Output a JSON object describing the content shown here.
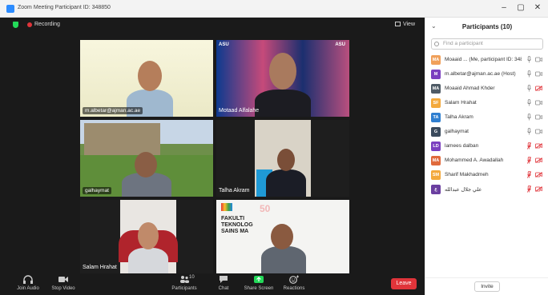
{
  "window": {
    "title": "Zoom Meeting Participant ID: 348850"
  },
  "meeting": {
    "recording_label": "Recording",
    "view_label": "View"
  },
  "tiles": [
    {
      "name": "m.albetar@ajman.ac.ae",
      "active_speaker": true
    },
    {
      "name": "Motaad Alfalahe"
    },
    {
      "name": "galhaymat"
    },
    {
      "name": "Talha Akram"
    },
    {
      "name": "Salam Hrahat"
    },
    {
      "name": ""
    }
  ],
  "tile_text": {
    "asu_logo": "ASU",
    "fakulti_banner": [
      "FAKULTI",
      "TEKNOLOG",
      "SAINS MA"
    ],
    "fakulti_number": "50"
  },
  "toolbar": {
    "join_audio": "Join Audio",
    "stop_video": "Stop Video",
    "participants": "Participants",
    "participants_count": "10",
    "chat": "Chat",
    "share_screen": "Share Screen",
    "reactions": "Reactions",
    "leave": "Leave"
  },
  "panel": {
    "title": "Participants (10)",
    "search_placeholder": "Find a participant",
    "invite": "Invite",
    "participants": [
      {
        "initials": "MA",
        "color": "#f0a05a",
        "name": "Moaaid ... (Me, participant ID: 348850)",
        "mic_muted": false,
        "cam_off": false
      },
      {
        "initials": "M",
        "color": "#7b3fbf",
        "name": "m.albetar@ajman.ac.ae (Host)",
        "mic_muted": false,
        "cam_off": false
      },
      {
        "initials": "MA",
        "color": "#4f5b66",
        "name": "Moaaid Ahmad Khder",
        "mic_muted": false,
        "cam_off": true
      },
      {
        "initials": "SF",
        "color": "#f3a93c",
        "name": "Salam Hrahat",
        "mic_muted": false,
        "cam_off": false
      },
      {
        "initials": "TA",
        "color": "#2f7fd0",
        "name": "Talha Akram",
        "mic_muted": false,
        "cam_off": false
      },
      {
        "initials": "G",
        "color": "#3a4a5c",
        "name": "galhaymat",
        "mic_muted": false,
        "cam_off": false
      },
      {
        "initials": "LD",
        "color": "#7b3fbf",
        "name": "lamees dalban",
        "mic_muted": true,
        "cam_off": true
      },
      {
        "initials": "MA",
        "color": "#e06a3c",
        "name": "Mohammed A. Awadallah",
        "mic_muted": true,
        "cam_off": true
      },
      {
        "initials": "SM",
        "color": "#f3a93c",
        "name": "Sharif Makhadmeh",
        "mic_muted": true,
        "cam_off": true
      },
      {
        "initials": "ع",
        "color": "#6b3fa0",
        "name": "علي جلال عبدالله",
        "mic_muted": true,
        "cam_off": true
      }
    ]
  },
  "colors": {
    "meeting_bg": "#1a1a1a",
    "speaker_outline": "#f2e94e",
    "leave_red": "#e0343a",
    "share_green": "#23d959",
    "muted_red": "#e0343a"
  }
}
